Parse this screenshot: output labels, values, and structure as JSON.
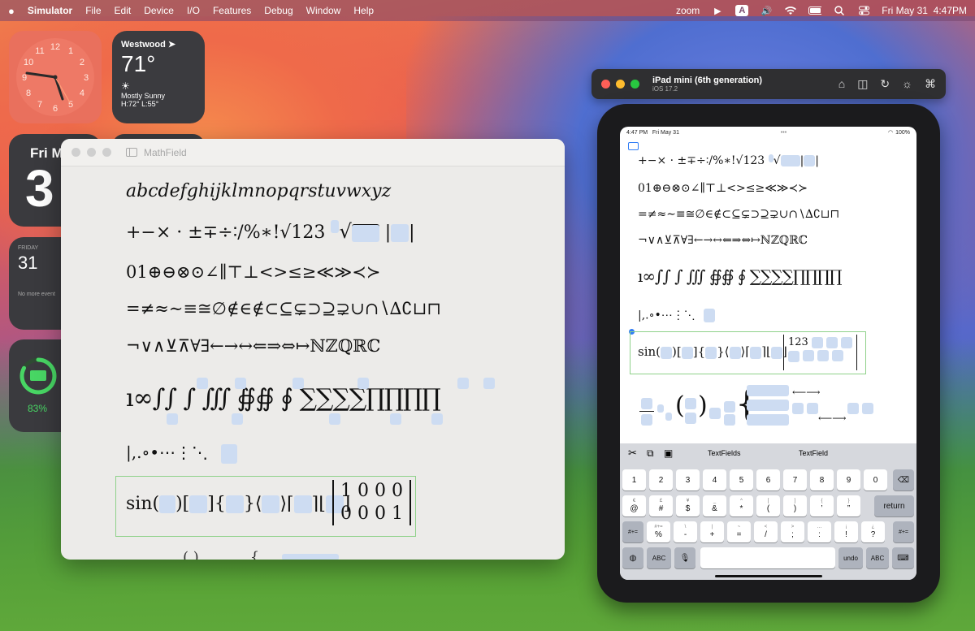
{
  "menubar": {
    "apple": "",
    "app": "Simulator",
    "menus": [
      "File",
      "Edit",
      "Device",
      "I/O",
      "Features",
      "Debug",
      "Window",
      "Help"
    ],
    "zoom": "zoom",
    "input_source": "A",
    "datetime": "Fri May 31  4:47PM"
  },
  "widgets": {
    "clock_numbers": [
      "12",
      "1",
      "2",
      "3",
      "4",
      "5",
      "6",
      "7",
      "8",
      "9",
      "10",
      "11"
    ],
    "weather": {
      "city": "Westwood",
      "temp": "71°",
      "condition": "Mostly Sunny",
      "hilo": "H:72° L:55°"
    },
    "date_day": "Fri M",
    "date_num": "3",
    "calendar": {
      "weekday": "FRIDAY",
      "day": "31",
      "note": "No more event"
    },
    "battery": {
      "percent": "83%",
      "level": 0.83
    }
  },
  "mathwin": {
    "title": "MathField",
    "rows": [
      "abcdefghijklmnopqrstuvwxyz",
      "+−× · ±∓÷∶/%∗!√123",
      "01⊕⊖⊗⊙∠∥⊤⊥<>≤≥≪≫≺≻",
      "=≠≈∼≡≅∅∉∈∉⊂⊆⊊⊃⊇⊋∪∩∖∆∁⊔⊓",
      "¬∨∧⊻⊼∀∃←→↔⇐⇒⇔↦ℕℤℚℝℂ",
      "ı∞∫∫ ∫ ∭ ∯∯ ∮ ∑∑∑∑∏∏∏∏",
      "|,.∘•⋯⋮⋱",
      "sin("
    ],
    "matrix": [
      [
        "1",
        "0",
        "0",
        "0"
      ],
      [
        "0",
        "0",
        "0",
        "1"
      ]
    ]
  },
  "simulator": {
    "device": "iPad mini (6th generation)",
    "os": "iOS 17.2",
    "status_time": "4:47 PM   Fri May 31",
    "status_dots": "•••",
    "status_batt": "100%",
    "rows": [
      "+−× · ±∓÷∶/%∗!√123",
      "01⊕⊖⊗⊙∠∥⊤⊥<>≤≥≪≫≺≻",
      "=≠≈∼≡≅∅∈∉⊂⊆⊊⊃⊇⊋∪∩∖∆∁⊔⊓",
      "¬∨∧⊻⊼∀∃←→↔⇐⇒⇔↦ℕℤℚℝℂ",
      "ı∞∫∫ ∫ ∭ ∯∯ ∮ ∑∑∑∑∏∏∏∏",
      "|,.∘•⋯⋮⋱",
      "sin("
    ],
    "matrix_val": "123",
    "keyboard": {
      "suggestions": [
        "TextFields",
        "TextField"
      ],
      "row1": [
        "1",
        "2",
        "3",
        "4",
        "5",
        "6",
        "7",
        "8",
        "9",
        "0"
      ],
      "row2": [
        [
          "@",
          "€"
        ],
        [
          "#",
          "£"
        ],
        [
          "$",
          "¥"
        ],
        [
          "&",
          "_"
        ],
        [
          "*",
          "^"
        ],
        [
          "(",
          "["
        ],
        [
          ")",
          "]"
        ],
        [
          "’",
          "{"
        ],
        [
          "”",
          "}"
        ]
      ],
      "row3": [
        [
          "%",
          "#+="
        ],
        [
          "-",
          "\\"
        ],
        [
          "+",
          "|"
        ],
        [
          "=",
          "~"
        ],
        [
          "/",
          "<"
        ],
        [
          ";",
          ">"
        ],
        [
          ":",
          "…"
        ],
        [
          "!",
          "¡"
        ],
        [
          "?",
          "¿"
        ]
      ],
      "return": "return",
      "shift": "#+=",
      "abc": "ABC",
      "undo": "undo",
      "abc2": "ABC"
    }
  }
}
